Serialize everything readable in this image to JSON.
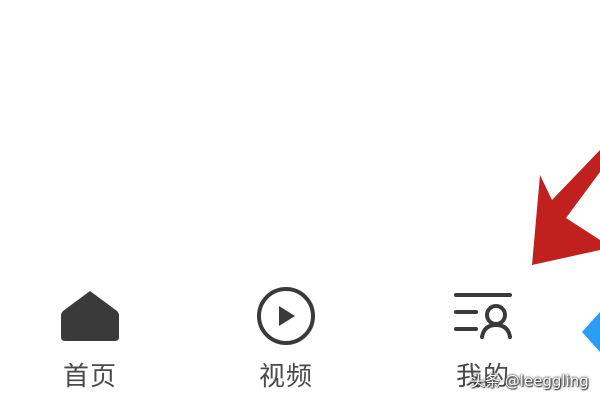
{
  "tabbar": {
    "tabs": [
      {
        "label": "首页",
        "icon": "home-icon"
      },
      {
        "label": "视频",
        "icon": "play-circle-icon"
      },
      {
        "label": "我的",
        "icon": "profile-icon"
      }
    ]
  },
  "annotation": {
    "shape": "arrow",
    "color": "#c0211f"
  },
  "watermark": {
    "text": "头条 @leeggling"
  },
  "colors": {
    "icon": "#3a3a3a",
    "label": "#4a4a4a",
    "edge_icon": "#2a9df4"
  }
}
